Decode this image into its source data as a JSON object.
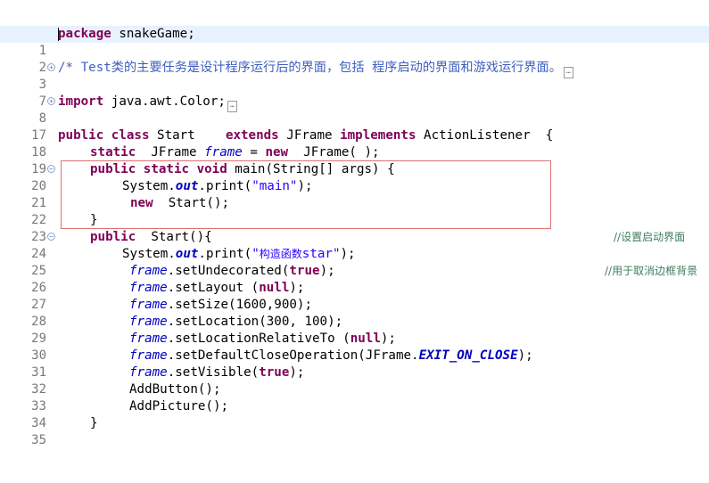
{
  "editor": {
    "lines": [
      {
        "n": "1",
        "text": "package snakeGame;"
      },
      {
        "n": "2",
        "text": ""
      },
      {
        "n": "3",
        "text": "/* Test类的主要任务是设计程序运行后的界面，包括 程序启动的界面和游戏运行界面。"
      },
      {
        "n": "7",
        "text": ""
      },
      {
        "n": "8",
        "text": "import java.awt.Color;"
      },
      {
        "n": "17",
        "text": ""
      },
      {
        "n": "18",
        "text": "public class Start    extends JFrame implements ActionListener  {"
      },
      {
        "n": "19",
        "text": "static  JFrame frame = new  JFrame( );"
      },
      {
        "n": "20",
        "text": "public static void main(String[] args) {"
      },
      {
        "n": "21",
        "text": "System.out.print(\"main\");"
      },
      {
        "n": "22",
        "text": "new  Start();"
      },
      {
        "n": "23",
        "text": "}"
      },
      {
        "n": "24",
        "text": "public  Start(){"
      },
      {
        "n": "25",
        "text": "System.out.print(\"构造函数star\");"
      },
      {
        "n": "26",
        "text": "frame.setUndecorated(true);"
      },
      {
        "n": "27",
        "text": "frame.setLayout (null);"
      },
      {
        "n": "28",
        "text": "frame.setSize(1600,900);"
      },
      {
        "n": "29",
        "text": "frame.setLocation(300, 100);"
      },
      {
        "n": "30",
        "text": "frame.setLocationRelativeTo (null);"
      },
      {
        "n": "31",
        "text": "frame.setDefaultCloseOperation(JFrame.EXIT_ON_CLOSE);"
      },
      {
        "n": "32",
        "text": "frame.setVisible(true);"
      },
      {
        "n": "33",
        "text": "AddButton();"
      },
      {
        "n": "34",
        "text": "AddPicture();"
      },
      {
        "n": "35",
        "text": "}"
      }
    ],
    "right_comments": {
      "line24": "//设置启动界面",
      "line26": "//用于取消边框背景"
    },
    "fold_markers": [
      "3",
      "8",
      "20",
      "24"
    ],
    "highlight_color": "#e07070",
    "current_line_color": "#e8f2fe"
  }
}
